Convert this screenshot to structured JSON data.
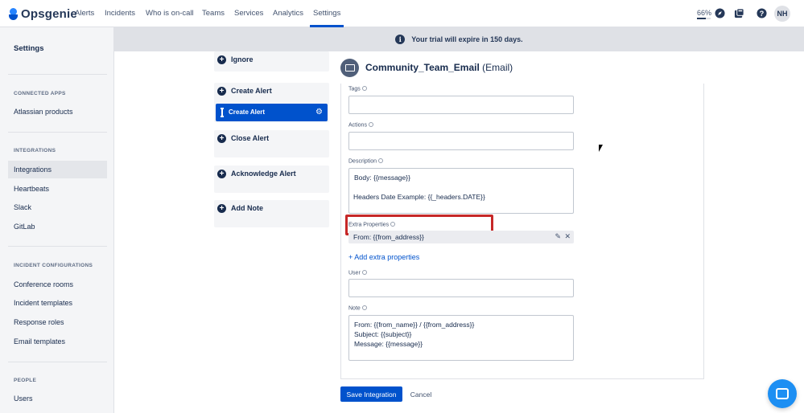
{
  "app": {
    "name": "Opsgenie"
  },
  "nav": {
    "items": [
      {
        "label": "Alerts"
      },
      {
        "label": "Incidents"
      },
      {
        "label": "Who is on-call"
      },
      {
        "label": "Teams"
      },
      {
        "label": "Services"
      },
      {
        "label": "Analytics"
      },
      {
        "label": "Settings"
      }
    ],
    "active": "Settings",
    "usage_percent": "66%",
    "usage_fraction": 0.66,
    "user_initials": "NH"
  },
  "sidebar": {
    "title": "Settings",
    "sections": [
      {
        "heading": "CONNECTED APPS",
        "items": [
          {
            "label": "Atlassian products"
          }
        ]
      },
      {
        "heading": "INTEGRATIONS",
        "items": [
          {
            "label": "Integrations"
          },
          {
            "label": "Heartbeats"
          },
          {
            "label": "Slack"
          },
          {
            "label": "GitLab"
          }
        ]
      },
      {
        "heading": "INCIDENT CONFIGURATIONS",
        "items": [
          {
            "label": "Conference rooms"
          },
          {
            "label": "Incident templates"
          },
          {
            "label": "Response roles"
          },
          {
            "label": "Email templates"
          }
        ]
      },
      {
        "heading": "PEOPLE",
        "items": [
          {
            "label": "Users"
          }
        ]
      }
    ]
  },
  "banner": {
    "text": "Your trial will expire in 150 days."
  },
  "actions": {
    "ignore": "Ignore",
    "create_alert": "Create Alert",
    "create_alert_selected": "Create Alert",
    "close_alert": "Close Alert",
    "acknowledge_alert": "Acknowledge Alert",
    "add_note": "Add Note"
  },
  "integration": {
    "name": "Community_Team_Email",
    "type": "(Email)"
  },
  "form": {
    "tags_label": "Tags",
    "tags_value": "",
    "actions_label": "Actions",
    "actions_value": "",
    "description_label": "Description",
    "description_lines": [
      "Body: {{message}}",
      "Headers Date Example: {{_headers.DATE}}"
    ],
    "extra_label": "Extra Properties",
    "extra_value": "From: {{from_address}}",
    "add_extra": "+ Add extra properties",
    "user_label": "User",
    "user_value": "",
    "note_label": "Note",
    "note_lines": [
      "From: {{from_name}} / {{from_address}}",
      "Subject: {{subject}}",
      "Message: {{message}}"
    ]
  },
  "buttons": {
    "save": "Save Integration",
    "cancel": "Cancel"
  },
  "colors": {
    "primary": "#0052cc",
    "highlight": "#c62828"
  }
}
